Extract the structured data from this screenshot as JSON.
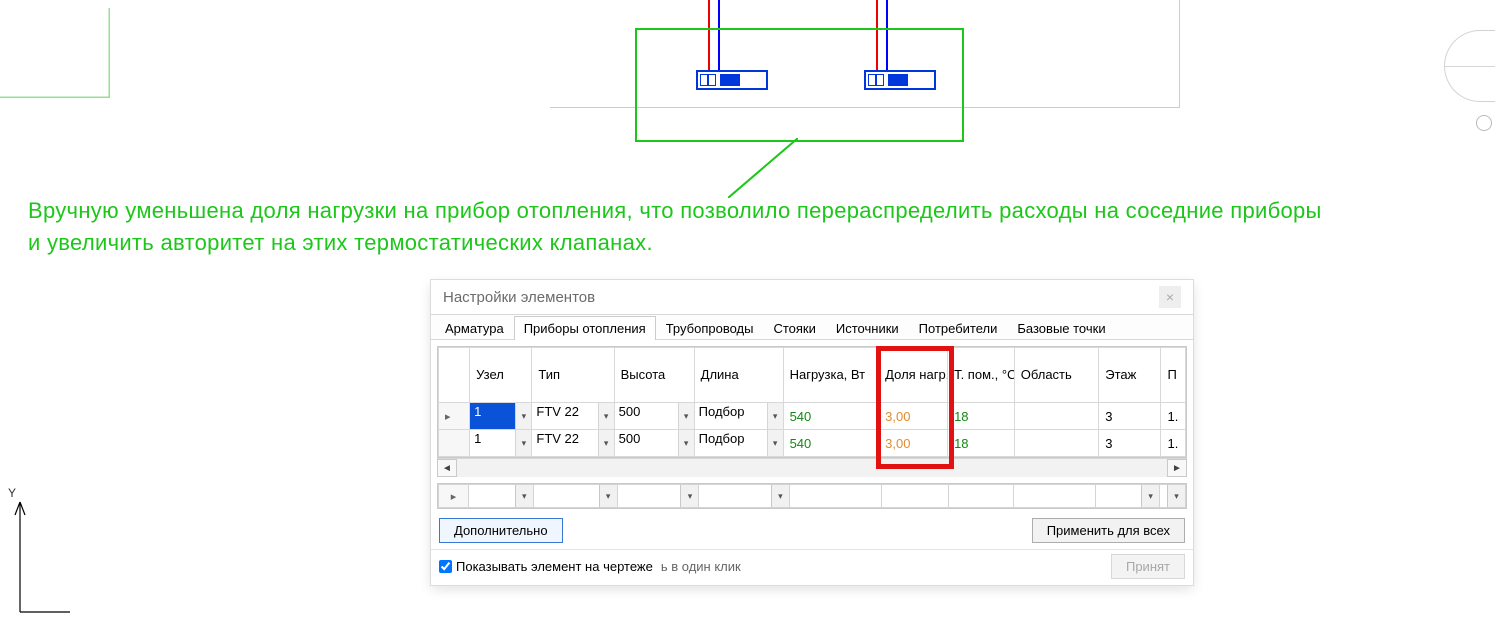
{
  "annotation": "Вручную уменьшена доля нагрузки на прибор отопления, что позволило перераспределить расходы на соседние приборы и увеличить авторитет на этих термостатических клапанах.",
  "dialog": {
    "title": "Настройки элементов",
    "close_glyph": "×",
    "tabs": [
      "Арматура",
      "Приборы отопления",
      "Трубопроводы",
      "Стояки",
      "Источники",
      "Потребители",
      "Базовые точки"
    ],
    "active_tab_index": 1,
    "columns": {
      "row": "",
      "uzel": "Узел",
      "tip": "Тип",
      "vysota": "Высота",
      "dlina": "Длина",
      "nagruzka": "Нагрузка, Вт",
      "dolia": "Доля нагр., %",
      "tpom": "Т. пом., °C",
      "oblast": "Область",
      "etazh": "Этаж",
      "more": "П"
    },
    "rows": [
      {
        "marker": "▸",
        "uzel": "1",
        "tip": "FTV 22",
        "vysota": "500",
        "dlina": "Подбор",
        "nagruzka": "540",
        "dolia": "3,00",
        "tpom": "18",
        "oblast": "",
        "etazh": "3",
        "more": "1."
      },
      {
        "marker": "",
        "uzel": "1",
        "tip": "FTV 22",
        "vysota": "500",
        "dlina": "Подбор",
        "nagruzka": "540",
        "dolia": "3,00",
        "tpom": "18",
        "oblast": "",
        "etazh": "3",
        "more": "1."
      }
    ],
    "filter_row_marker": "▸",
    "buttons": {
      "more": "Дополнительно",
      "apply_all": "Применить для всех",
      "accept": "Принят"
    },
    "footer": {
      "checkbox_label": "Показывать элемент на чертеже",
      "one_click": "ь в один клик"
    },
    "dropdown_glyph": "▾",
    "scroll_left": "◄",
    "scroll_right": "►"
  },
  "axis_label": "Y"
}
